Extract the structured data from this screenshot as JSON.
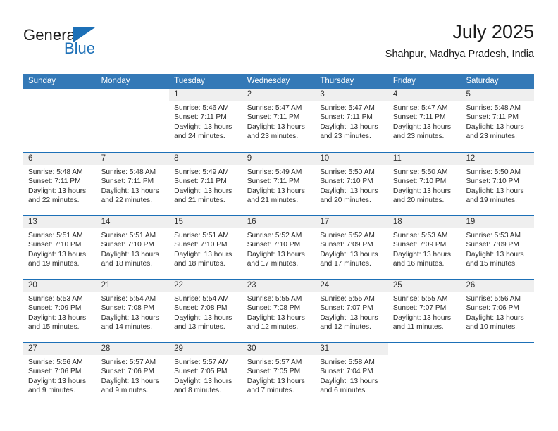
{
  "brand": {
    "name_dark": "General",
    "name_blue": "Blue",
    "accent_color": "#1d70b7"
  },
  "header": {
    "month_title": "July 2025",
    "location": "Shahpur, Madhya Pradesh, India"
  },
  "calendar": {
    "header_bg": "#3479b7",
    "separator_color": "#1d70b7",
    "daynum_band_color": "#efefef",
    "weekdays": [
      "Sunday",
      "Monday",
      "Tuesday",
      "Wednesday",
      "Thursday",
      "Friday",
      "Saturday"
    ],
    "weeks": [
      [
        {
          "day": "",
          "sunrise": "",
          "sunset": "",
          "daylight_1": "",
          "daylight_2": ""
        },
        {
          "day": "",
          "sunrise": "",
          "sunset": "",
          "daylight_1": "",
          "daylight_2": ""
        },
        {
          "day": "1",
          "sunrise": "Sunrise: 5:46 AM",
          "sunset": "Sunset: 7:11 PM",
          "daylight_1": "Daylight: 13 hours",
          "daylight_2": "and 24 minutes."
        },
        {
          "day": "2",
          "sunrise": "Sunrise: 5:47 AM",
          "sunset": "Sunset: 7:11 PM",
          "daylight_1": "Daylight: 13 hours",
          "daylight_2": "and 23 minutes."
        },
        {
          "day": "3",
          "sunrise": "Sunrise: 5:47 AM",
          "sunset": "Sunset: 7:11 PM",
          "daylight_1": "Daylight: 13 hours",
          "daylight_2": "and 23 minutes."
        },
        {
          "day": "4",
          "sunrise": "Sunrise: 5:47 AM",
          "sunset": "Sunset: 7:11 PM",
          "daylight_1": "Daylight: 13 hours",
          "daylight_2": "and 23 minutes."
        },
        {
          "day": "5",
          "sunrise": "Sunrise: 5:48 AM",
          "sunset": "Sunset: 7:11 PM",
          "daylight_1": "Daylight: 13 hours",
          "daylight_2": "and 23 minutes."
        }
      ],
      [
        {
          "day": "6",
          "sunrise": "Sunrise: 5:48 AM",
          "sunset": "Sunset: 7:11 PM",
          "daylight_1": "Daylight: 13 hours",
          "daylight_2": "and 22 minutes."
        },
        {
          "day": "7",
          "sunrise": "Sunrise: 5:48 AM",
          "sunset": "Sunset: 7:11 PM",
          "daylight_1": "Daylight: 13 hours",
          "daylight_2": "and 22 minutes."
        },
        {
          "day": "8",
          "sunrise": "Sunrise: 5:49 AM",
          "sunset": "Sunset: 7:11 PM",
          "daylight_1": "Daylight: 13 hours",
          "daylight_2": "and 21 minutes."
        },
        {
          "day": "9",
          "sunrise": "Sunrise: 5:49 AM",
          "sunset": "Sunset: 7:11 PM",
          "daylight_1": "Daylight: 13 hours",
          "daylight_2": "and 21 minutes."
        },
        {
          "day": "10",
          "sunrise": "Sunrise: 5:50 AM",
          "sunset": "Sunset: 7:10 PM",
          "daylight_1": "Daylight: 13 hours",
          "daylight_2": "and 20 minutes."
        },
        {
          "day": "11",
          "sunrise": "Sunrise: 5:50 AM",
          "sunset": "Sunset: 7:10 PM",
          "daylight_1": "Daylight: 13 hours",
          "daylight_2": "and 20 minutes."
        },
        {
          "day": "12",
          "sunrise": "Sunrise: 5:50 AM",
          "sunset": "Sunset: 7:10 PM",
          "daylight_1": "Daylight: 13 hours",
          "daylight_2": "and 19 minutes."
        }
      ],
      [
        {
          "day": "13",
          "sunrise": "Sunrise: 5:51 AM",
          "sunset": "Sunset: 7:10 PM",
          "daylight_1": "Daylight: 13 hours",
          "daylight_2": "and 19 minutes."
        },
        {
          "day": "14",
          "sunrise": "Sunrise: 5:51 AM",
          "sunset": "Sunset: 7:10 PM",
          "daylight_1": "Daylight: 13 hours",
          "daylight_2": "and 18 minutes."
        },
        {
          "day": "15",
          "sunrise": "Sunrise: 5:51 AM",
          "sunset": "Sunset: 7:10 PM",
          "daylight_1": "Daylight: 13 hours",
          "daylight_2": "and 18 minutes."
        },
        {
          "day": "16",
          "sunrise": "Sunrise: 5:52 AM",
          "sunset": "Sunset: 7:10 PM",
          "daylight_1": "Daylight: 13 hours",
          "daylight_2": "and 17 minutes."
        },
        {
          "day": "17",
          "sunrise": "Sunrise: 5:52 AM",
          "sunset": "Sunset: 7:09 PM",
          "daylight_1": "Daylight: 13 hours",
          "daylight_2": "and 17 minutes."
        },
        {
          "day": "18",
          "sunrise": "Sunrise: 5:53 AM",
          "sunset": "Sunset: 7:09 PM",
          "daylight_1": "Daylight: 13 hours",
          "daylight_2": "and 16 minutes."
        },
        {
          "day": "19",
          "sunrise": "Sunrise: 5:53 AM",
          "sunset": "Sunset: 7:09 PM",
          "daylight_1": "Daylight: 13 hours",
          "daylight_2": "and 15 minutes."
        }
      ],
      [
        {
          "day": "20",
          "sunrise": "Sunrise: 5:53 AM",
          "sunset": "Sunset: 7:09 PM",
          "daylight_1": "Daylight: 13 hours",
          "daylight_2": "and 15 minutes."
        },
        {
          "day": "21",
          "sunrise": "Sunrise: 5:54 AM",
          "sunset": "Sunset: 7:08 PM",
          "daylight_1": "Daylight: 13 hours",
          "daylight_2": "and 14 minutes."
        },
        {
          "day": "22",
          "sunrise": "Sunrise: 5:54 AM",
          "sunset": "Sunset: 7:08 PM",
          "daylight_1": "Daylight: 13 hours",
          "daylight_2": "and 13 minutes."
        },
        {
          "day": "23",
          "sunrise": "Sunrise: 5:55 AM",
          "sunset": "Sunset: 7:08 PM",
          "daylight_1": "Daylight: 13 hours",
          "daylight_2": "and 12 minutes."
        },
        {
          "day": "24",
          "sunrise": "Sunrise: 5:55 AM",
          "sunset": "Sunset: 7:07 PM",
          "daylight_1": "Daylight: 13 hours",
          "daylight_2": "and 12 minutes."
        },
        {
          "day": "25",
          "sunrise": "Sunrise: 5:55 AM",
          "sunset": "Sunset: 7:07 PM",
          "daylight_1": "Daylight: 13 hours",
          "daylight_2": "and 11 minutes."
        },
        {
          "day": "26",
          "sunrise": "Sunrise: 5:56 AM",
          "sunset": "Sunset: 7:06 PM",
          "daylight_1": "Daylight: 13 hours",
          "daylight_2": "and 10 minutes."
        }
      ],
      [
        {
          "day": "27",
          "sunrise": "Sunrise: 5:56 AM",
          "sunset": "Sunset: 7:06 PM",
          "daylight_1": "Daylight: 13 hours",
          "daylight_2": "and 9 minutes."
        },
        {
          "day": "28",
          "sunrise": "Sunrise: 5:57 AM",
          "sunset": "Sunset: 7:06 PM",
          "daylight_1": "Daylight: 13 hours",
          "daylight_2": "and 9 minutes."
        },
        {
          "day": "29",
          "sunrise": "Sunrise: 5:57 AM",
          "sunset": "Sunset: 7:05 PM",
          "daylight_1": "Daylight: 13 hours",
          "daylight_2": "and 8 minutes."
        },
        {
          "day": "30",
          "sunrise": "Sunrise: 5:57 AM",
          "sunset": "Sunset: 7:05 PM",
          "daylight_1": "Daylight: 13 hours",
          "daylight_2": "and 7 minutes."
        },
        {
          "day": "31",
          "sunrise": "Sunrise: 5:58 AM",
          "sunset": "Sunset: 7:04 PM",
          "daylight_1": "Daylight: 13 hours",
          "daylight_2": "and 6 minutes."
        },
        {
          "day": "",
          "sunrise": "",
          "sunset": "",
          "daylight_1": "",
          "daylight_2": ""
        },
        {
          "day": "",
          "sunrise": "",
          "sunset": "",
          "daylight_1": "",
          "daylight_2": ""
        }
      ]
    ]
  }
}
